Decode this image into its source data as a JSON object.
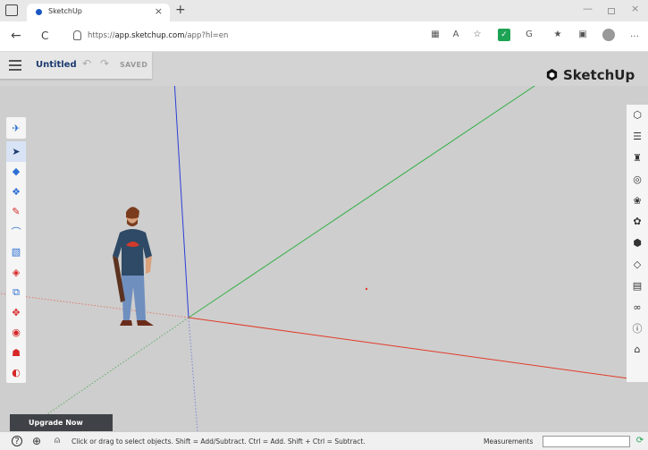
{
  "browser": {
    "tab_title": "SketchUp",
    "tab_close": "×",
    "new_tab": "+",
    "url_prefix": "https://",
    "url_host": "app.sketchup.com",
    "url_path": "/app?hl=en",
    "win_min": "—",
    "win_close": "×",
    "nav_back": "←",
    "nav_reload": "C"
  },
  "header": {
    "doc_title": "Untitled",
    "undo_glyph": "↶",
    "redo_glyph": "↷",
    "saved_label": "SAVED",
    "logo_text": "SketchUp"
  },
  "left_toolbar": {
    "top_tool": "search-scene-tool",
    "tools": [
      {
        "name": "select",
        "glyph": "➤",
        "color": "#1b3b6f",
        "active": true
      },
      {
        "name": "eraser",
        "glyph": "◆",
        "color": "#2d6fd1"
      },
      {
        "name": "paint-bucket",
        "glyph": "❖",
        "color": "#2d6fd1"
      },
      {
        "name": "pencil",
        "glyph": "✎",
        "color": "#d62828"
      },
      {
        "name": "arc",
        "glyph": "⌒",
        "color": "#2d6fd1"
      },
      {
        "name": "rectangle",
        "glyph": "▧",
        "color": "#2d6fd1"
      },
      {
        "name": "push-pull",
        "glyph": "◈",
        "color": "#d62828"
      },
      {
        "name": "offset",
        "glyph": "⧉",
        "color": "#2d6fd1"
      },
      {
        "name": "move",
        "glyph": "✥",
        "color": "#d62828"
      },
      {
        "name": "orbit",
        "glyph": "◉",
        "color": "#d62828"
      },
      {
        "name": "walk",
        "glyph": "☗",
        "color": "#d62828"
      },
      {
        "name": "section-plane",
        "glyph": "◐",
        "color": "#d62828"
      }
    ]
  },
  "right_toolbar": {
    "tools": [
      {
        "name": "entity-info",
        "glyph": "⬡"
      },
      {
        "name": "outliner",
        "glyph": "☰"
      },
      {
        "name": "instructor",
        "glyph": "♜"
      },
      {
        "name": "materials",
        "glyph": "◎"
      },
      {
        "name": "components",
        "glyph": "❀"
      },
      {
        "name": "styles",
        "glyph": "✿"
      },
      {
        "name": "layers",
        "glyph": "⬢"
      },
      {
        "name": "shadows",
        "glyph": "◇"
      },
      {
        "name": "scenes",
        "glyph": "▤"
      },
      {
        "name": "display",
        "glyph": "∞"
      },
      {
        "name": "info",
        "glyph": "ⓘ"
      },
      {
        "name": "extension-warehouse",
        "glyph": "⌂"
      }
    ]
  },
  "upgrade_label": "Upgrade Now",
  "status": {
    "hint": "Click or drag to select objects. Shift = Add/Subtract. Ctrl = Add. Shift + Ctrl = Subtract.",
    "measurements_label": "Measurements",
    "measurements_value": "",
    "help_glyph": "?",
    "globe_glyph": "⊕",
    "person_glyph": "⍝"
  }
}
